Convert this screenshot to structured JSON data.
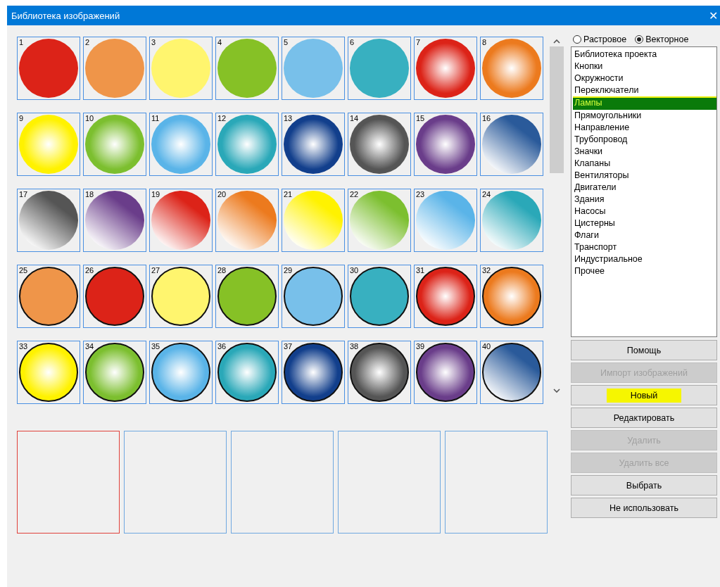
{
  "window": {
    "title": "Библиотека изображений",
    "close": "✕"
  },
  "tiles": [
    {
      "number": "1",
      "color": "#dc2318",
      "kind": "flat",
      "outlined": false
    },
    {
      "number": "2",
      "color": "#ef9549",
      "kind": "flat",
      "outlined": false
    },
    {
      "number": "3",
      "color": "#fff56e",
      "kind": "flat",
      "outlined": false
    },
    {
      "number": "4",
      "color": "#86c126",
      "kind": "flat",
      "outlined": false
    },
    {
      "number": "5",
      "color": "#78c0ea",
      "kind": "flat",
      "outlined": false
    },
    {
      "number": "6",
      "color": "#38b0c0",
      "kind": "flat",
      "outlined": false
    },
    {
      "number": "7",
      "color": "#dc2318",
      "kind": "radial",
      "outlined": false
    },
    {
      "number": "8",
      "color": "#ec7a1e",
      "kind": "radial",
      "outlined": false
    },
    {
      "number": "9",
      "color": "#fff200",
      "kind": "radial",
      "outlined": false
    },
    {
      "number": "10",
      "color": "#7cbf2f",
      "kind": "radial",
      "outlined": false
    },
    {
      "number": "11",
      "color": "#5ab4e8",
      "kind": "radial",
      "outlined": false
    },
    {
      "number": "12",
      "color": "#2aa8b8",
      "kind": "radial",
      "outlined": false
    },
    {
      "number": "13",
      "color": "#123f8c",
      "kind": "radial",
      "outlined": false
    },
    {
      "number": "14",
      "color": "#555555",
      "kind": "radial",
      "outlined": false
    },
    {
      "number": "15",
      "color": "#6a3d8a",
      "kind": "radial",
      "outlined": false
    },
    {
      "number": "16",
      "color": "#2a5a9a",
      "kind": "fade",
      "outlined": false
    },
    {
      "number": "17",
      "color": "#555555",
      "kind": "fade",
      "outlined": false
    },
    {
      "number": "18",
      "color": "#6a3d8a",
      "kind": "fade",
      "outlined": false
    },
    {
      "number": "19",
      "color": "#dc2318",
      "kind": "fade",
      "outlined": false
    },
    {
      "number": "20",
      "color": "#ec7a1e",
      "kind": "fade",
      "outlined": false
    },
    {
      "number": "21",
      "color": "#fff200",
      "kind": "fade",
      "outlined": false
    },
    {
      "number": "22",
      "color": "#7cbf2f",
      "kind": "fade",
      "outlined": false
    },
    {
      "number": "23",
      "color": "#5ab4e8",
      "kind": "fade",
      "outlined": false
    },
    {
      "number": "24",
      "color": "#2aa8b8",
      "kind": "fade",
      "outlined": false
    },
    {
      "number": "25",
      "color": "#ef9549",
      "kind": "flat",
      "outlined": true
    },
    {
      "number": "26",
      "color": "#dc2318",
      "kind": "flat",
      "outlined": true
    },
    {
      "number": "27",
      "color": "#fff56e",
      "kind": "flat",
      "outlined": true
    },
    {
      "number": "28",
      "color": "#86c126",
      "kind": "flat",
      "outlined": true
    },
    {
      "number": "29",
      "color": "#78c0ea",
      "kind": "flat",
      "outlined": true
    },
    {
      "number": "30",
      "color": "#38b0c0",
      "kind": "flat",
      "outlined": true
    },
    {
      "number": "31",
      "color": "#dc2318",
      "kind": "radial",
      "outlined": true
    },
    {
      "number": "32",
      "color": "#ec7a1e",
      "kind": "radial",
      "outlined": true
    },
    {
      "number": "33",
      "color": "#fff200",
      "kind": "radial",
      "outlined": true
    },
    {
      "number": "34",
      "color": "#7cbf2f",
      "kind": "radial",
      "outlined": true
    },
    {
      "number": "35",
      "color": "#5ab4e8",
      "kind": "radial",
      "outlined": true
    },
    {
      "number": "36",
      "color": "#2aa8b8",
      "kind": "radial",
      "outlined": true
    },
    {
      "number": "37",
      "color": "#123f8c",
      "kind": "radial",
      "outlined": true
    },
    {
      "number": "38",
      "color": "#555555",
      "kind": "radial",
      "outlined": true
    },
    {
      "number": "39",
      "color": "#6a3d8a",
      "kind": "radial",
      "outlined": true
    },
    {
      "number": "40",
      "color": "#2a5a9a",
      "kind": "fade",
      "outlined": true
    }
  ],
  "slots": [
    {
      "selected": true
    },
    {
      "selected": false
    },
    {
      "selected": false
    },
    {
      "selected": false
    },
    {
      "selected": false
    }
  ],
  "image_type": [
    {
      "label": "Растровое",
      "selected": false
    },
    {
      "label": "Векторное",
      "selected": true
    }
  ],
  "categories": [
    {
      "label": "Библиотека проекта",
      "selected": false
    },
    {
      "label": "Кнопки",
      "selected": false
    },
    {
      "label": "Окружности",
      "selected": false
    },
    {
      "label": "Переключатели",
      "selected": false
    },
    {
      "label": "Лампы",
      "selected": true
    },
    {
      "label": "Прямоугольники",
      "selected": false
    },
    {
      "label": "Направление",
      "selected": false
    },
    {
      "label": "Трубопровод",
      "selected": false
    },
    {
      "label": "Значки",
      "selected": false
    },
    {
      "label": "Клапаны",
      "selected": false
    },
    {
      "label": "Вентиляторы",
      "selected": false
    },
    {
      "label": "Двигатели",
      "selected": false
    },
    {
      "label": "Здания",
      "selected": false
    },
    {
      "label": "Насосы",
      "selected": false
    },
    {
      "label": "Цистерны",
      "selected": false
    },
    {
      "label": "Флаги",
      "selected": false
    },
    {
      "label": "Транспорт",
      "selected": false
    },
    {
      "label": "Индустриальное",
      "selected": false
    },
    {
      "label": "Прочее",
      "selected": false
    }
  ],
  "buttons": [
    {
      "label": "Помощь",
      "disabled": false,
      "highlighted": false
    },
    {
      "label": "Импорт изображений",
      "disabled": true,
      "highlighted": false
    },
    {
      "label": "Новый",
      "disabled": false,
      "highlighted": true
    },
    {
      "label": "Редактировать",
      "disabled": false,
      "highlighted": false
    },
    {
      "label": "Удалить",
      "disabled": true,
      "highlighted": false
    },
    {
      "label": "Удалить все",
      "disabled": true,
      "highlighted": false
    },
    {
      "label": "Выбрать",
      "disabled": false,
      "highlighted": false
    },
    {
      "label": "Не использовать",
      "disabled": false,
      "highlighted": false
    }
  ]
}
